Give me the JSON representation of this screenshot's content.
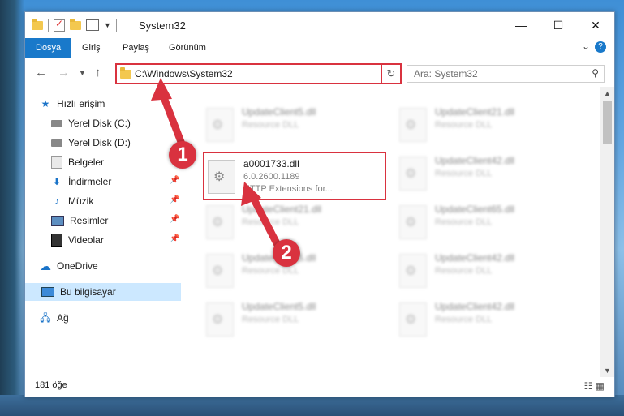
{
  "window": {
    "title": "System32",
    "controls": {
      "minimize": "—",
      "maximize": "☐",
      "close": "✕"
    }
  },
  "ribbon": {
    "tabs": [
      "Dosya",
      "Giriş",
      "Paylaş",
      "Görünüm"
    ]
  },
  "address": {
    "path": "C:\\Windows\\System32",
    "search_placeholder": "Ara: System32"
  },
  "nav": {
    "items": [
      {
        "label": "Hızlı erişim",
        "icon": "star-icon"
      },
      {
        "label": "Yerel Disk (C:)",
        "icon": "drive-icon"
      },
      {
        "label": "Yerel Disk (D:)",
        "icon": "drive-icon"
      },
      {
        "label": "Belgeler",
        "icon": "documents-icon"
      },
      {
        "label": "İndirmeler",
        "icon": "download-icon"
      },
      {
        "label": "Müzik",
        "icon": "music-icon"
      },
      {
        "label": "Resimler",
        "icon": "pictures-icon"
      },
      {
        "label": "Videolar",
        "icon": "videos-icon"
      },
      {
        "label": "OneDrive",
        "icon": "cloud-icon"
      },
      {
        "label": "Bu bilgisayar",
        "icon": "computer-icon"
      },
      {
        "label": "Ağ",
        "icon": "network-icon"
      }
    ]
  },
  "files": {
    "left": [
      {
        "name": "UpdateClient5.dll",
        "desc": "Resource DLL"
      },
      {
        "name": "a0001733.dll",
        "version": "6.0.2600.1189",
        "desc": "HTTP Extensions for..."
      },
      {
        "name": "UpdateClient21.dll",
        "desc": "Resource DLL"
      },
      {
        "name": "UpdateClient5.dll",
        "desc": "Resource DLL"
      },
      {
        "name": "UpdateClient5.dll",
        "desc": "Resource DLL"
      }
    ],
    "right": [
      {
        "name": "UpdateClient21.dll",
        "desc": "Resource DLL"
      },
      {
        "name": "UpdateClient42.dll",
        "desc": "Resource DLL"
      },
      {
        "name": "UpdateClient65.dll",
        "desc": "Resource DLL"
      },
      {
        "name": "UpdateClient42.dll",
        "desc": "Resource DLL"
      },
      {
        "name": "UpdateClient42.dll",
        "desc": "Resource DLL"
      }
    ]
  },
  "status": {
    "count": "181 öğe"
  },
  "annotations": {
    "marker1": "1",
    "marker2": "2"
  },
  "colors": {
    "accent": "#1979ca",
    "highlight": "#d9323f",
    "selected": "#cce8ff"
  }
}
